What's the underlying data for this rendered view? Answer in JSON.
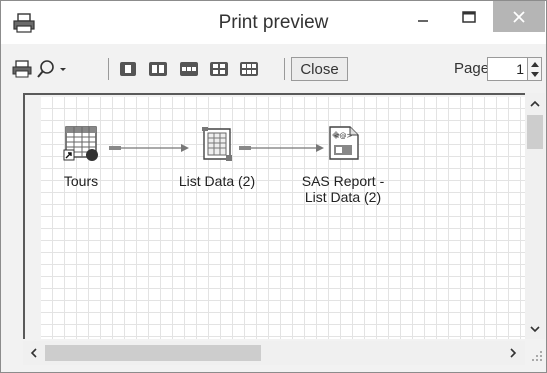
{
  "window": {
    "title": "Print preview"
  },
  "toolbar": {
    "close_label": "Close",
    "page_label": "Page",
    "page_value": "1"
  },
  "flow": {
    "nodes": [
      {
        "label": "Tours",
        "icon": "table-icon"
      },
      {
        "label": "List Data (2)",
        "icon": "list-data-icon"
      },
      {
        "label": "SAS Report -\nList Data (2)",
        "icon": "sas-report-icon"
      }
    ]
  }
}
